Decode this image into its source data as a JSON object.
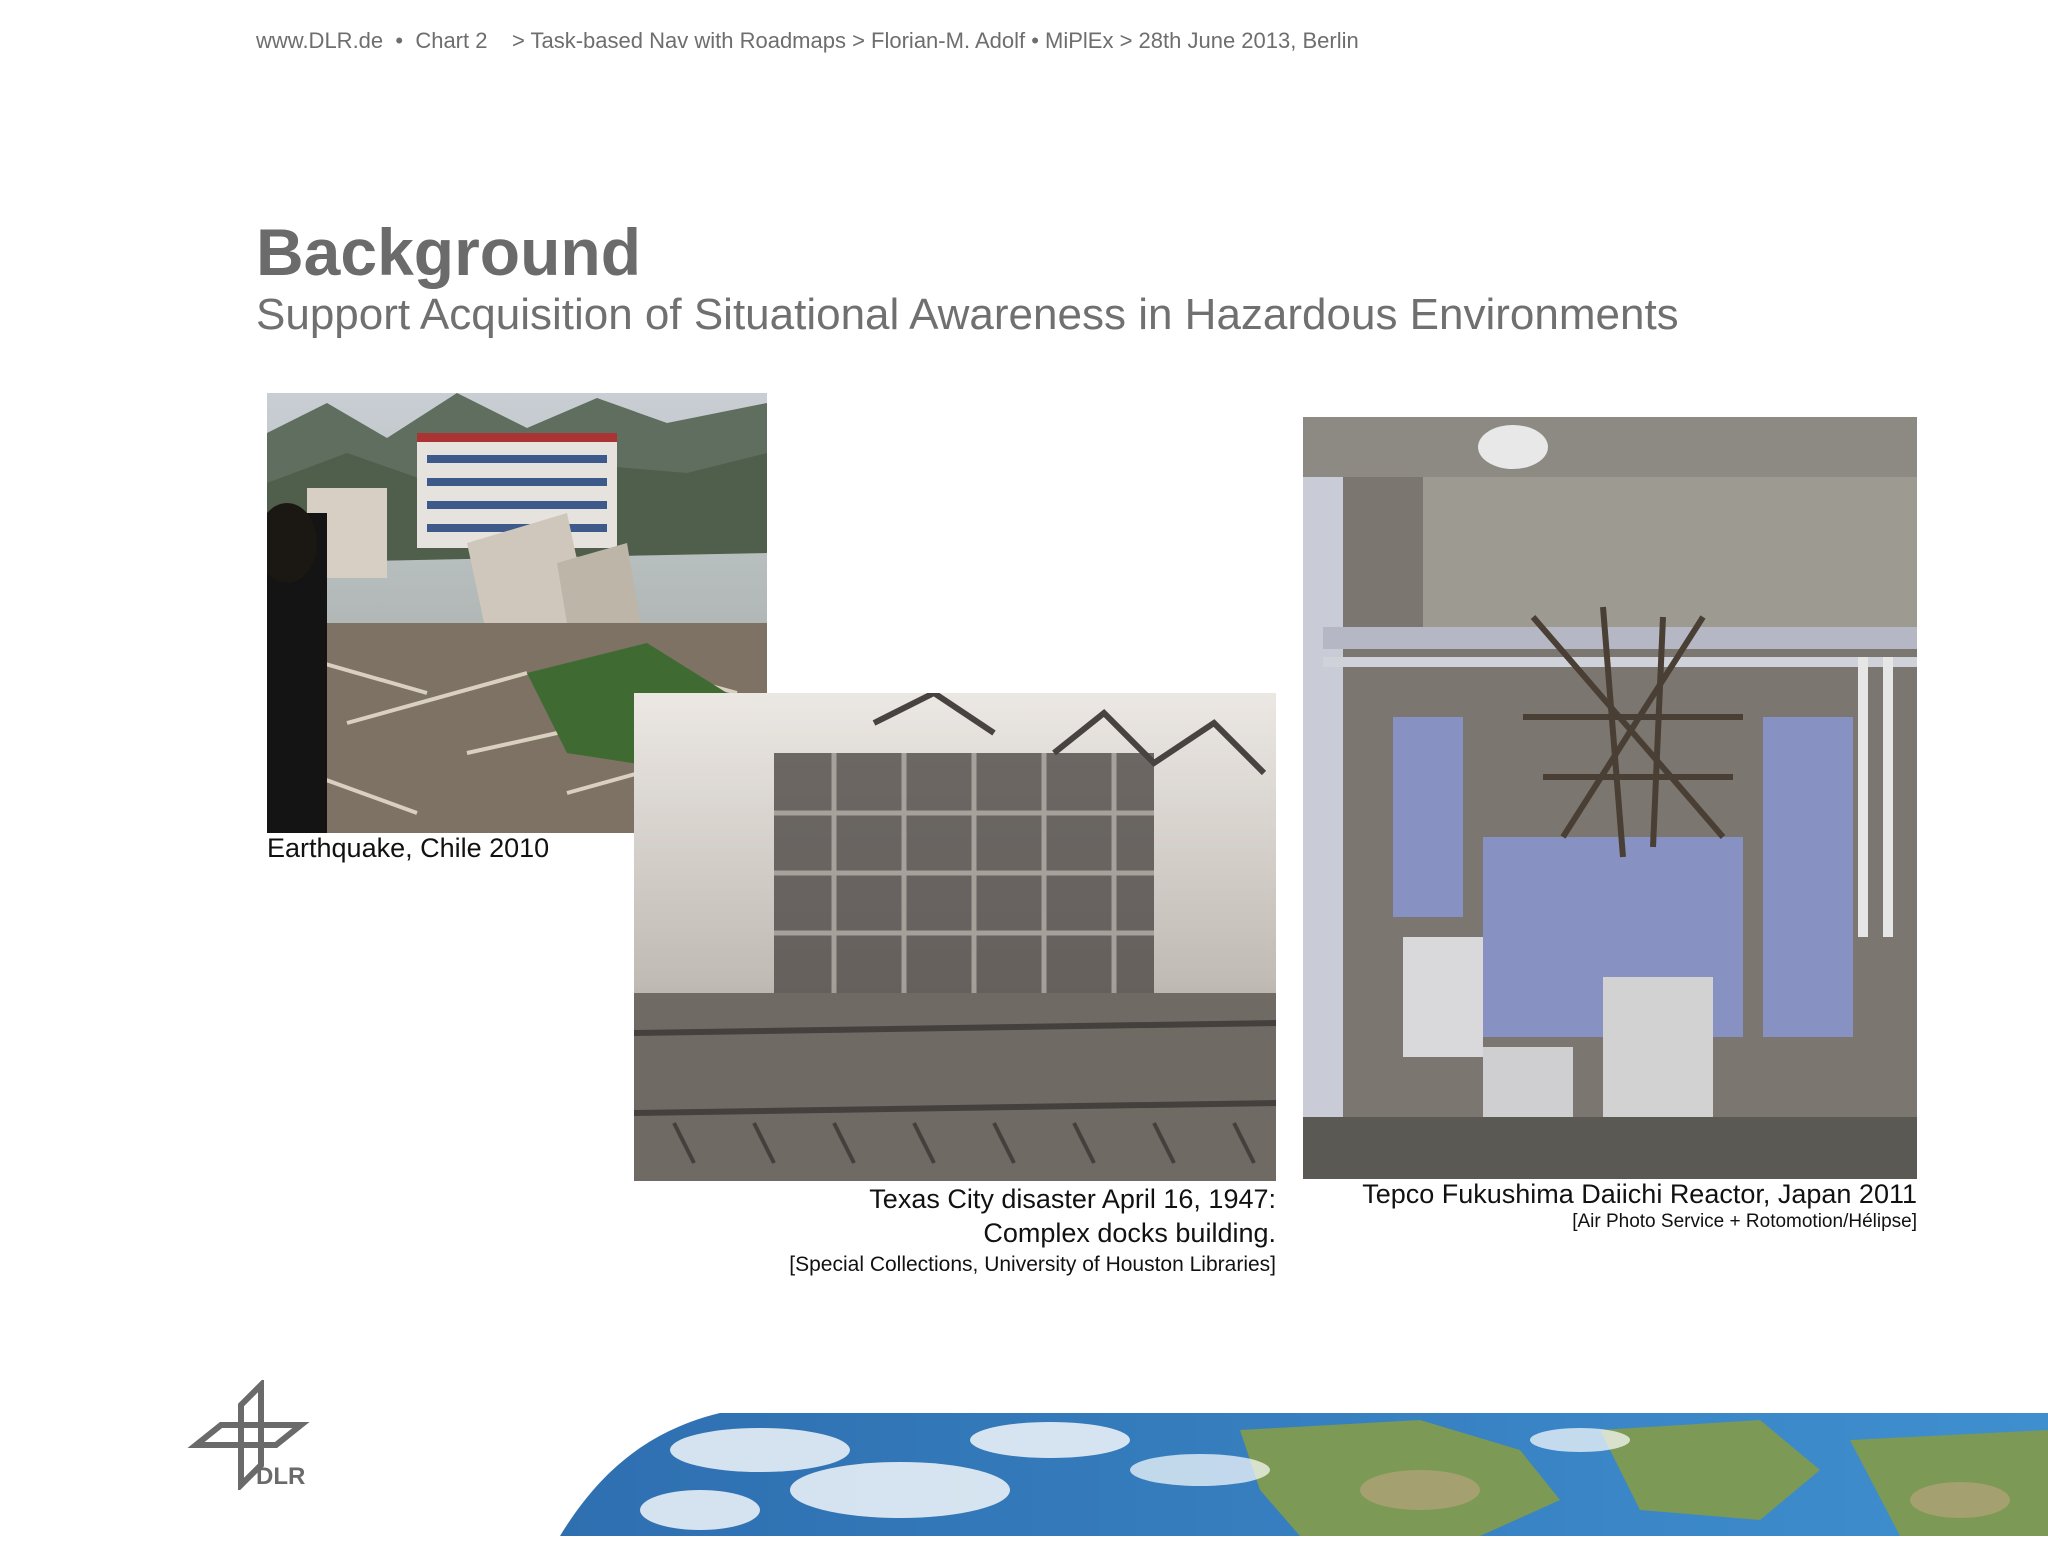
{
  "header": {
    "site": "www.DLR.de",
    "separator": "•",
    "chart": "Chart 2",
    "breadcrumb": "> Task-based Nav with Roadmaps > Florian-M. Adolf • MiPlEx > 28th June 2013, Berlin"
  },
  "slide": {
    "title": "Background",
    "subtitle": "Support Acquisition of Situational Awareness in Hazardous Environments"
  },
  "photos": [
    {
      "caption": "Earthquake, Chile 2010"
    },
    {
      "caption_line1": "Texas City disaster April 16, 1947:",
      "caption_line2": "Complex docks building.",
      "credit": "[Special Collections, University of Houston Libraries]"
    },
    {
      "caption": "Tepco Fukushima Daiichi Reactor, Japan 2011",
      "credit": "[Air Photo Service + Rotomotion/Hélipse]"
    }
  ],
  "logo": {
    "text": "DLR"
  },
  "colors": {
    "title": "#6b6b6b",
    "text": "#111111",
    "header": "#6e6e6e"
  }
}
